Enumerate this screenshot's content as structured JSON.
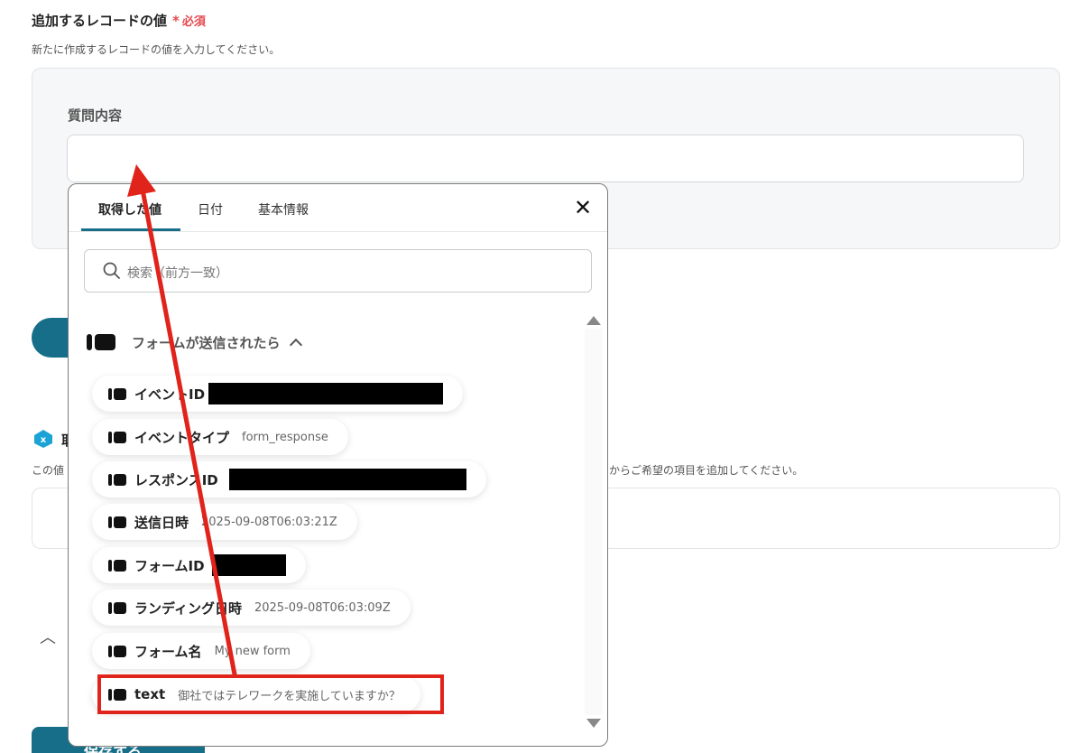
{
  "section": {
    "title": "追加するレコードの値",
    "required_star": "*",
    "required_label": "必須",
    "description": "新たに作成するレコードの値を入力してください。"
  },
  "field": {
    "label": "質問内容",
    "value": ""
  },
  "background": {
    "heading_fragment": "取",
    "desc_left": "この値",
    "desc_right": "からご希望の項目を追加してください。",
    "bottom_button": "保存する"
  },
  "popup": {
    "tabs": [
      "取得した値",
      "日付",
      "基本情報"
    ],
    "active_tab": "取得した値",
    "close_glyph": "✕",
    "search_placeholder": "検索（前方一致）",
    "group_title": "フォームが送信されたら",
    "items": [
      {
        "name": "イベントID",
        "value": "",
        "redacted": true
      },
      {
        "name": "イベントタイプ",
        "value": "form_response",
        "redacted": false
      },
      {
        "name": "レスポンスID",
        "value": "",
        "redacted": true
      },
      {
        "name": "送信日時",
        "value": "2025-09-08T06:03:21Z",
        "redacted": false
      },
      {
        "name": "フォームID",
        "value": "",
        "redacted": true
      },
      {
        "name": "ランディング日時",
        "value": "2025-09-08T06:03:09Z",
        "redacted": false
      },
      {
        "name": "フォーム名",
        "value": "My new form",
        "redacted": false
      },
      {
        "name": "text",
        "value": "御社ではテレワークを実施していますか？",
        "redacted": false
      }
    ]
  },
  "annotation": {
    "color": "#e0231b",
    "highlighted_item": "text"
  },
  "colors": {
    "accent": "#176e88",
    "required": "#e5484d"
  }
}
